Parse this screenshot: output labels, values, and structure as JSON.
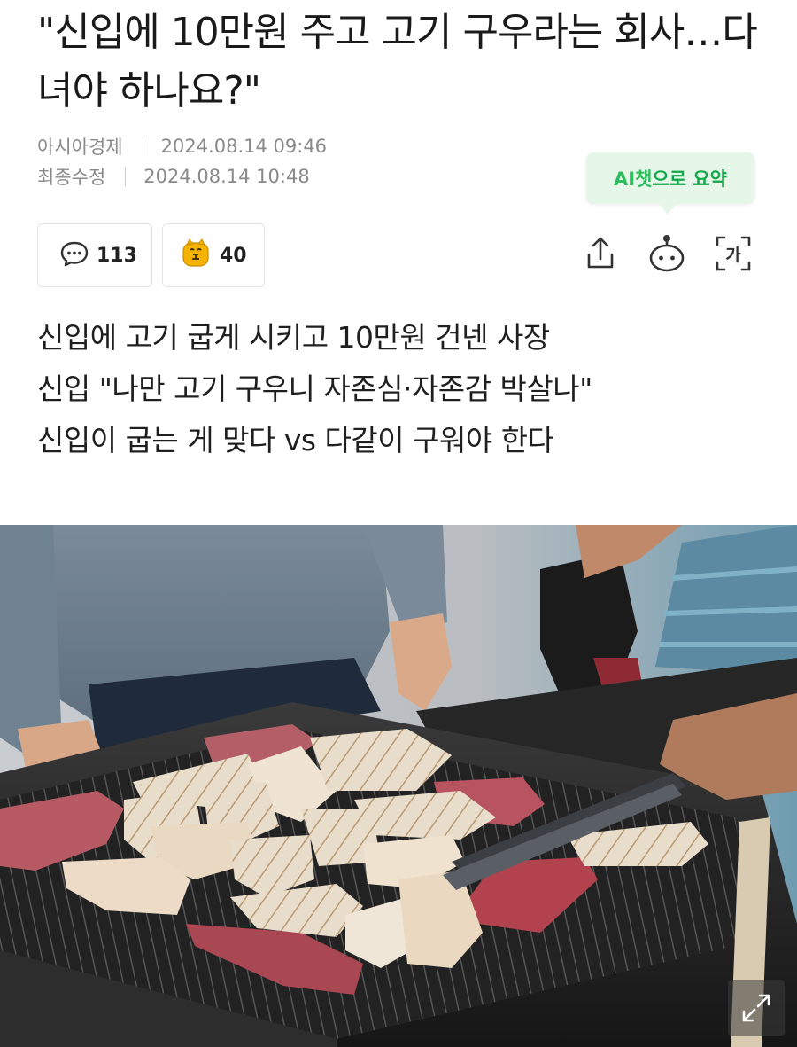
{
  "article": {
    "title": "\"신입에 10만원 주고 고기 구우라는 회사…다녀야 하나요?\"",
    "publisher": "아시아경제",
    "published": "2024.08.14 09:46",
    "modified_label": "최종수정",
    "modified": "2024.08.14 10:48"
  },
  "ai_summary": {
    "label_prefix": "AI챗",
    "label_suffix": "으로 요약"
  },
  "reactions": {
    "comment_count": "113",
    "like_count": "40",
    "comment_icon": "speech-bubble-icon",
    "like_icon": "emoji-face-icon"
  },
  "toolbar": {
    "share_icon": "share-icon",
    "bot_icon": "chatbot-icon",
    "font_icon": "font-size-icon",
    "font_label": "가"
  },
  "summary_lines": [
    "신입에 고기 굽게 시키고 10만원 건넨 사장",
    "신입 \"나만 고기 구우니 자존심·자존감 박살나\"",
    "신입이 굽는 게 맞다 vs 다같이 구워야 한다"
  ],
  "photo": {
    "expand_icon": "expand-icon"
  },
  "colors": {
    "accent_green": "#11a94a",
    "badge_bg": "#e6f7ea",
    "meta_gray": "#8a8a8a"
  }
}
